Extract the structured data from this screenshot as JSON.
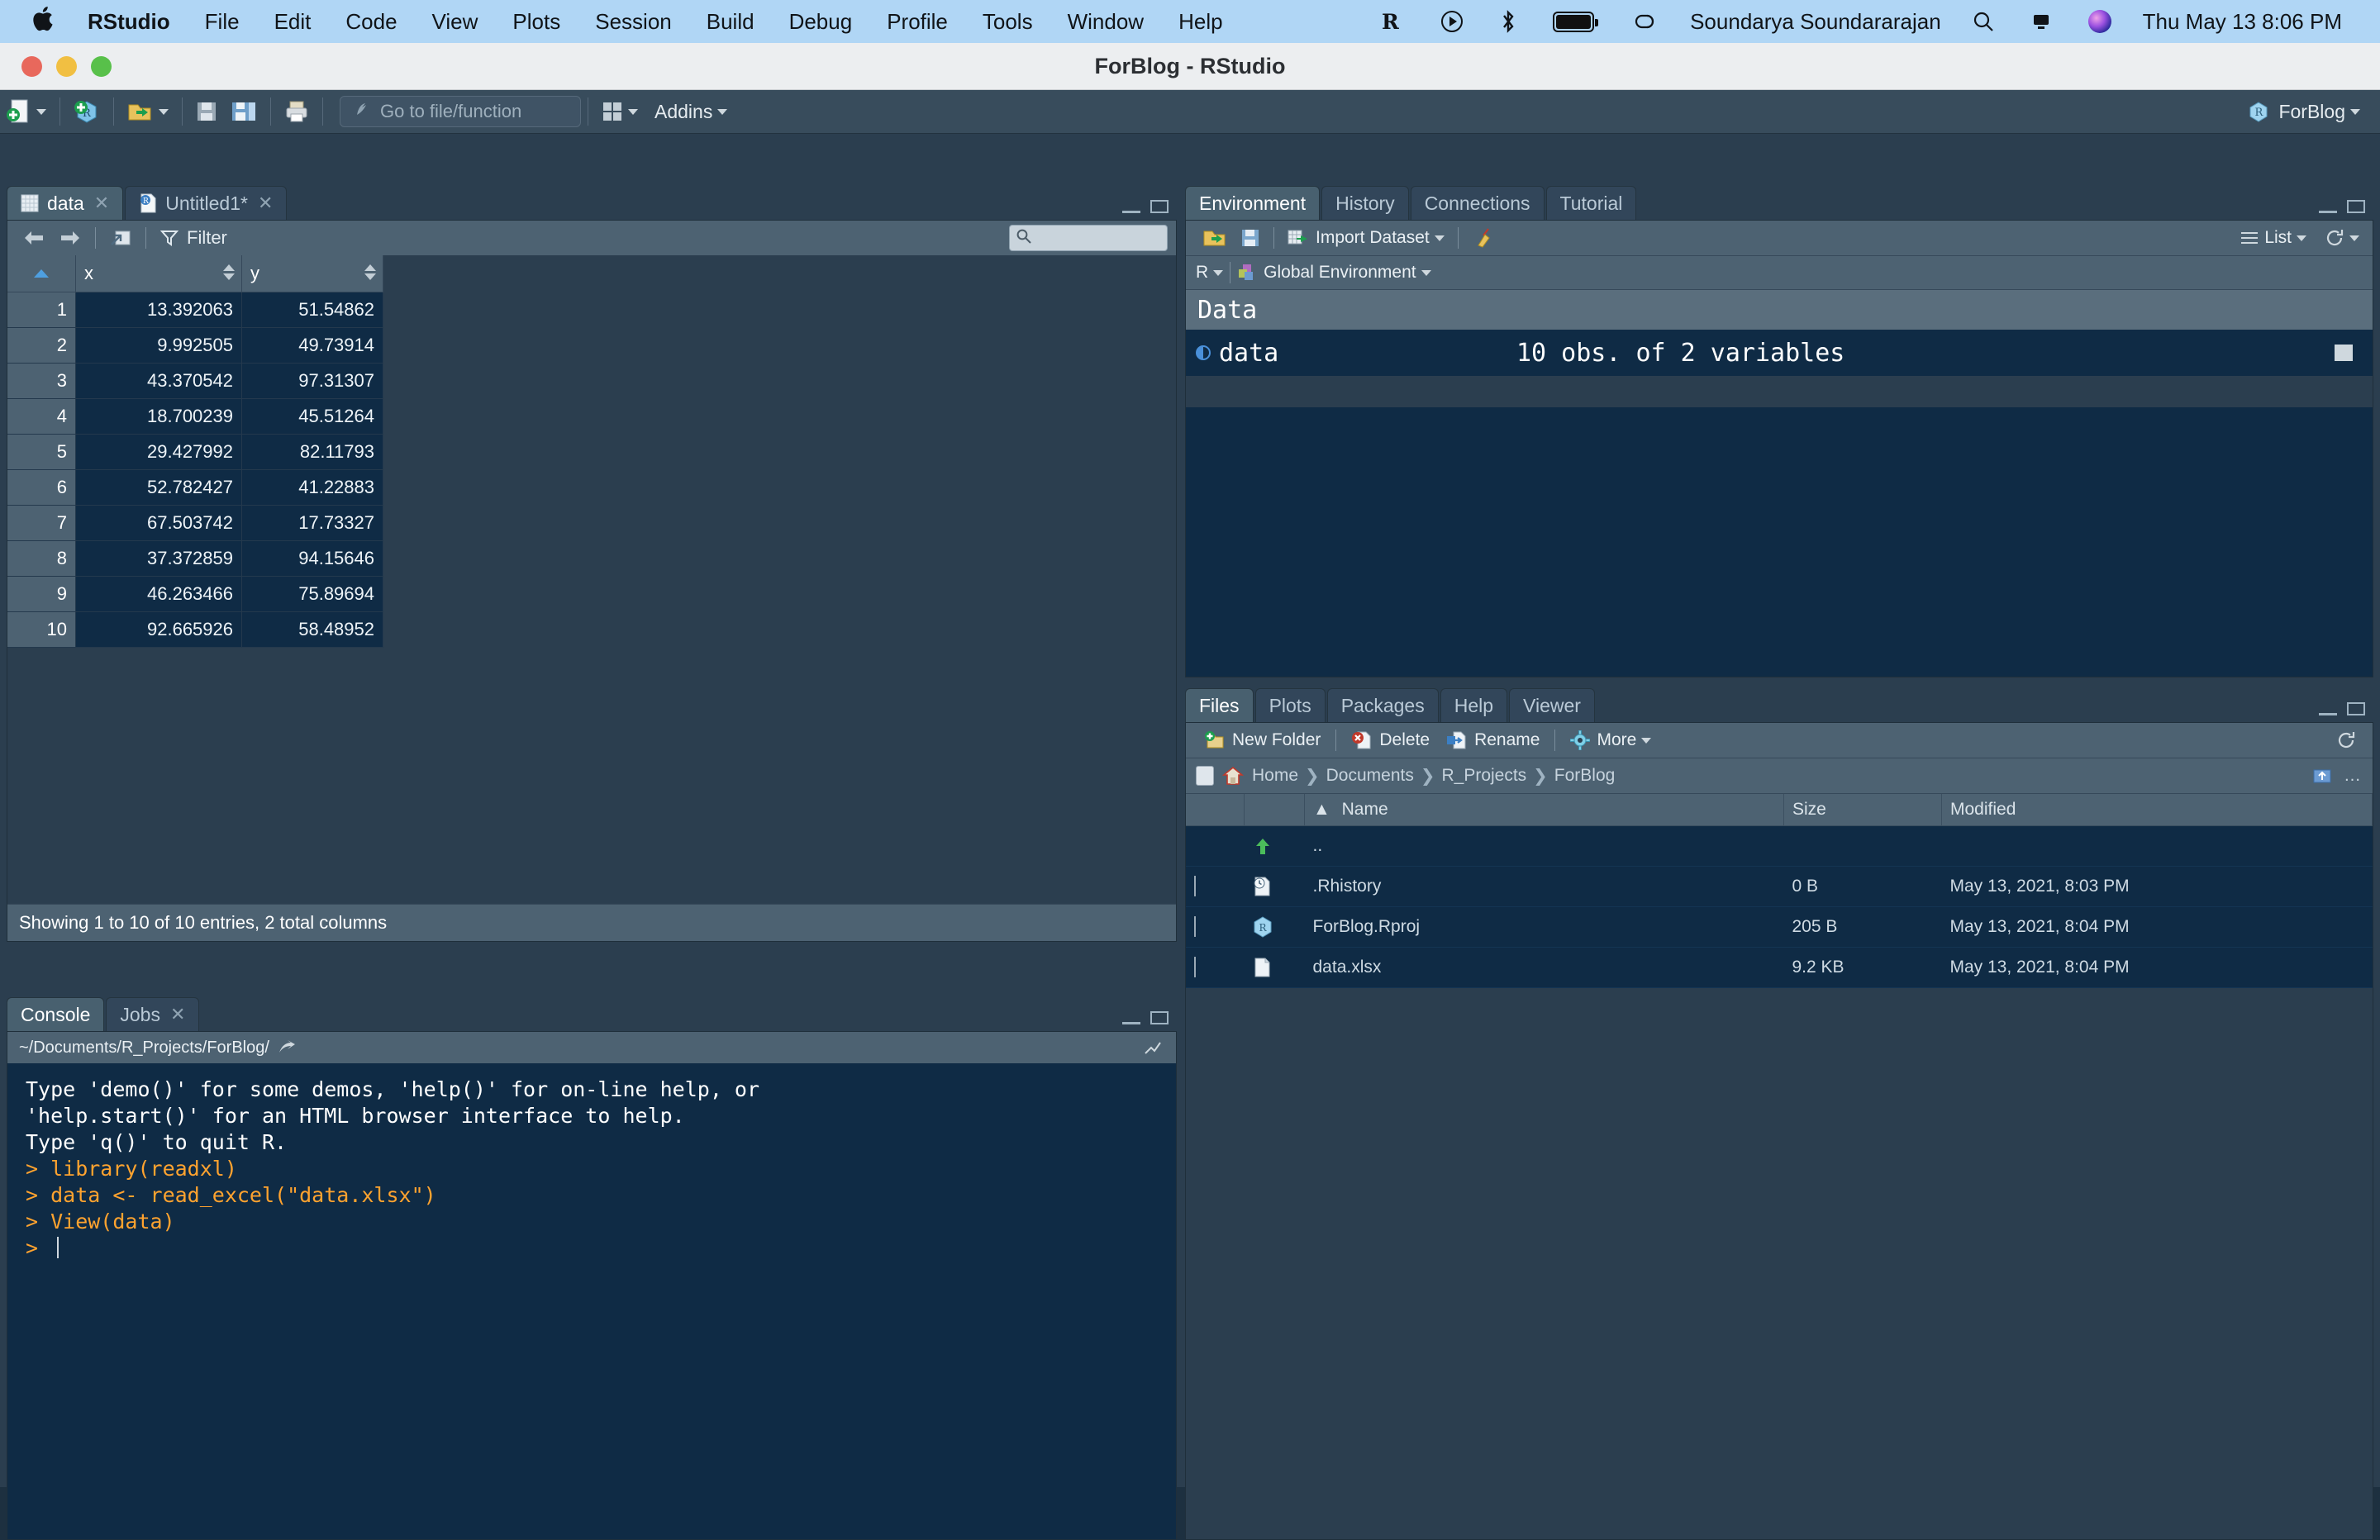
{
  "menubar": {
    "apple_icon": "apple-logo",
    "items": [
      "RStudio",
      "File",
      "Edit",
      "Code",
      "View",
      "Plots",
      "Session",
      "Build",
      "Debug",
      "Profile",
      "Tools",
      "Window",
      "Help"
    ],
    "status_icons": [
      "r-icon",
      "play-circle-icon",
      "bluetooth-icon",
      "battery-icon",
      "link-icon"
    ],
    "user": "Soundarya Soundararajan",
    "right_icons": [
      "search-icon",
      "control-center-icon",
      "siri-icon"
    ],
    "datetime": "Thu May 13  8:06 PM"
  },
  "window": {
    "title": "ForBlog - RStudio",
    "traffic_lights": [
      "close-button",
      "minimize-button",
      "zoom-button"
    ]
  },
  "toolbar": {
    "new_file": "new-file-icon",
    "new_project": "new-project-icon",
    "open_file": "open-file-icon",
    "save": "save-icon",
    "save_all": "save-all-icon",
    "print": "print-icon",
    "goto_placeholder": "Go to file/function",
    "panes_icon": "workspace-panes-icon",
    "addins": "Addins",
    "project": "ForBlog"
  },
  "source_pane": {
    "tabs": [
      {
        "label": "data",
        "icon": "data-grid-icon",
        "active": true,
        "closable": true
      },
      {
        "label": "Untitled1*",
        "icon": "r-script-icon",
        "active": false,
        "closable": true
      }
    ],
    "toolbar": {
      "back": "back-arrow-icon",
      "forward": "forward-arrow-icon",
      "popout": "popout-window-icon",
      "filter": "Filter",
      "filter_icon": "funnel-icon",
      "search_placeholder": ""
    },
    "table": {
      "columns": [
        "",
        "x",
        "y"
      ],
      "rows": [
        {
          "n": "1",
          "x": "13.392063",
          "y": "51.54862"
        },
        {
          "n": "2",
          "x": "9.992505",
          "y": "49.73914"
        },
        {
          "n": "3",
          "x": "43.370542",
          "y": "97.31307"
        },
        {
          "n": "4",
          "x": "18.700239",
          "y": "45.51264"
        },
        {
          "n": "5",
          "x": "29.427992",
          "y": "82.11793"
        },
        {
          "n": "6",
          "x": "52.782427",
          "y": "41.22883"
        },
        {
          "n": "7",
          "x": "67.503742",
          "y": "17.73327"
        },
        {
          "n": "8",
          "x": "37.372859",
          "y": "94.15646"
        },
        {
          "n": "9",
          "x": "46.263466",
          "y": "75.89694"
        },
        {
          "n": "10",
          "x": "92.665926",
          "y": "58.48952"
        }
      ]
    },
    "status": "Showing 1 to 10 of 10 entries, 2 total columns"
  },
  "console_pane": {
    "tabs": [
      {
        "label": "Console",
        "active": true,
        "closable": false
      },
      {
        "label": "Jobs",
        "active": false,
        "closable": true
      }
    ],
    "path": "~/Documents/R_Projects/ForBlog/",
    "lines": [
      {
        "text": "Type 'demo()' for some demos, 'help()' for on-line help, or",
        "type": "output"
      },
      {
        "text": "'help.start()' for an HTML browser interface to help.",
        "type": "output"
      },
      {
        "text": "Type 'q()' to quit R.",
        "type": "output"
      },
      {
        "text": "",
        "type": "output"
      },
      {
        "text": "> library(readxl)",
        "type": "command"
      },
      {
        "text": "> data <- read_excel(\"data.xlsx\")",
        "type": "command"
      },
      {
        "text": "> View(data)",
        "type": "command"
      },
      {
        "text": "> ",
        "type": "command"
      }
    ]
  },
  "env_pane": {
    "tabs": [
      {
        "label": "Environment",
        "active": true
      },
      {
        "label": "History",
        "active": false
      },
      {
        "label": "Connections",
        "active": false
      },
      {
        "label": "Tutorial",
        "active": false
      }
    ],
    "toolbar": {
      "load": "open-folder-icon",
      "save": "save-icon",
      "import": "Import Dataset",
      "import_icon": "import-dataset-icon",
      "clear": "broom-icon",
      "list_label": "List",
      "list_icon": "list-icon",
      "refresh": "refresh-icon"
    },
    "scope": {
      "language": "R",
      "environment": "Global Environment",
      "env_icon": "cubes-icon"
    },
    "section_title": "Data",
    "objects": [
      {
        "name": "data",
        "value": "10 obs. of 2 variables",
        "expandable": true,
        "grid_icon": "table-view-icon"
      }
    ]
  },
  "files_pane": {
    "tabs": [
      {
        "label": "Files",
        "active": true
      },
      {
        "label": "Plots",
        "active": false
      },
      {
        "label": "Packages",
        "active": false
      },
      {
        "label": "Help",
        "active": false
      },
      {
        "label": "Viewer",
        "active": false
      }
    ],
    "toolbar": {
      "new_folder": "New Folder",
      "new_folder_icon": "new-folder-icon",
      "delete": "Delete",
      "delete_icon": "delete-icon",
      "rename": "Rename",
      "rename_icon": "rename-icon",
      "more": "More",
      "more_icon": "gear-icon",
      "refresh_icon": "refresh-icon"
    },
    "breadcrumb": {
      "home_icon": "home-icon",
      "parts": [
        "Home",
        "Documents",
        "R_Projects",
        "ForBlog"
      ],
      "more_icon": "ellipsis-icon",
      "upload_icon": "upload-icon"
    },
    "columns": [
      "",
      "",
      "Name",
      "Size",
      "Modified"
    ],
    "rows": [
      {
        "icon": "folder-up-icon",
        "name": "..",
        "size": "",
        "modified": "",
        "checkbox": false
      },
      {
        "icon": "rhistory-file-icon",
        "name": ".Rhistory",
        "size": "0 B",
        "modified": "May 13, 2021, 8:03 PM",
        "checkbox": true
      },
      {
        "icon": "rproj-file-icon",
        "name": "ForBlog.Rproj",
        "size": "205 B",
        "modified": "May 13, 2021, 8:04 PM",
        "checkbox": true
      },
      {
        "icon": "xlsx-file-icon",
        "name": "data.xlsx",
        "size": "9.2 KB",
        "modified": "May 13, 2021, 8:04 PM",
        "checkbox": true
      }
    ]
  },
  "colors": {
    "menubar_bg": "#b0d6f5",
    "pane_bg": "#2b3e4f",
    "panel_header": "#4d6272",
    "console_bg": "#0f2b45",
    "command_orange": "#ffa32f",
    "accent_blue": "#4e9fe0"
  }
}
